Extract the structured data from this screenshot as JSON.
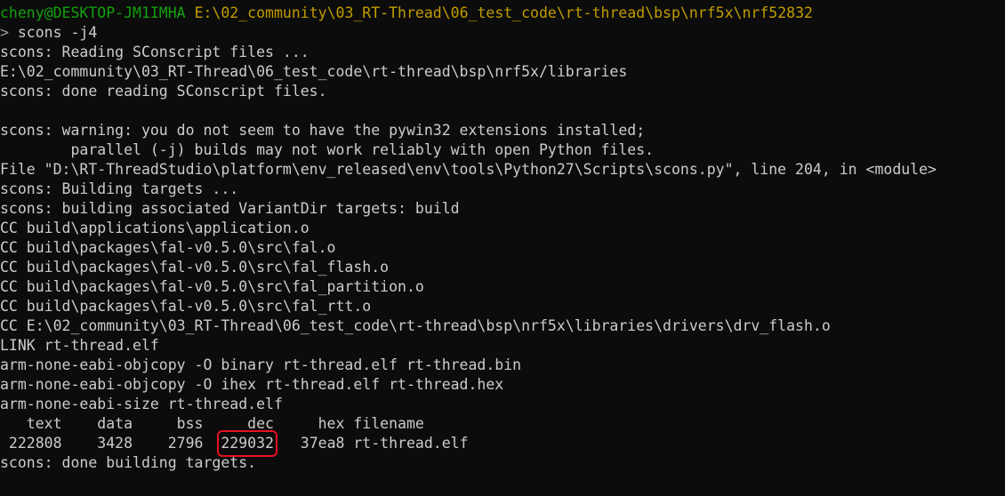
{
  "terminal": {
    "prompt": {
      "user_host": "cheny@DESKTOP-JM1IMHA",
      "path": "E:\\02_community\\03_RT-Thread\\06_test_code\\rt-thread\\bsp\\nrf5x\\nrf52832",
      "arrow": ">",
      "command": "scons -j4"
    },
    "lines": [
      "scons: Reading SConscript files ...",
      "E:\\02_community\\03_RT-Thread\\06_test_code\\rt-thread\\bsp\\nrf5x/libraries",
      "scons: done reading SConscript files.",
      "",
      "scons: warning: you do not seem to have the pywin32 extensions installed;",
      "        parallel (-j) builds may not work reliably with open Python files.",
      "File \"D:\\RT-ThreadStudio\\platform\\env_released\\env\\tools\\Python27\\Scripts\\scons.py\", line 204, in <module>",
      "scons: Building targets ...",
      "scons: building associated VariantDir targets: build",
      "CC build\\applications\\application.o",
      "CC build\\packages\\fal-v0.5.0\\src\\fal.o",
      "CC build\\packages\\fal-v0.5.0\\src\\fal_flash.o",
      "CC build\\packages\\fal-v0.5.0\\src\\fal_partition.o",
      "CC build\\packages\\fal-v0.5.0\\src\\fal_rtt.o",
      "CC E:\\02_community\\03_RT-Thread\\06_test_code\\rt-thread\\bsp\\nrf5x\\libraries\\drivers\\drv_flash.o",
      "LINK rt-thread.elf",
      "arm-none-eabi-objcopy -O binary rt-thread.elf rt-thread.bin",
      "arm-none-eabi-objcopy -O ihex rt-thread.elf rt-thread.hex",
      "arm-none-eabi-size rt-thread.elf"
    ],
    "size_header": "   text    data     bss     dec     hex filename",
    "size_row": {
      "lead": " 222808    3428    2796  ",
      "dec": "229032",
      "tail": "   37ea8 rt-thread.elf"
    },
    "final_line": "scons: done building targets.",
    "colors": {
      "background": "#0c0c0c",
      "text": "#cccccc",
      "user_host": "#13a10e",
      "path": "#c19c00",
      "highlight_box": "#e81123"
    }
  }
}
